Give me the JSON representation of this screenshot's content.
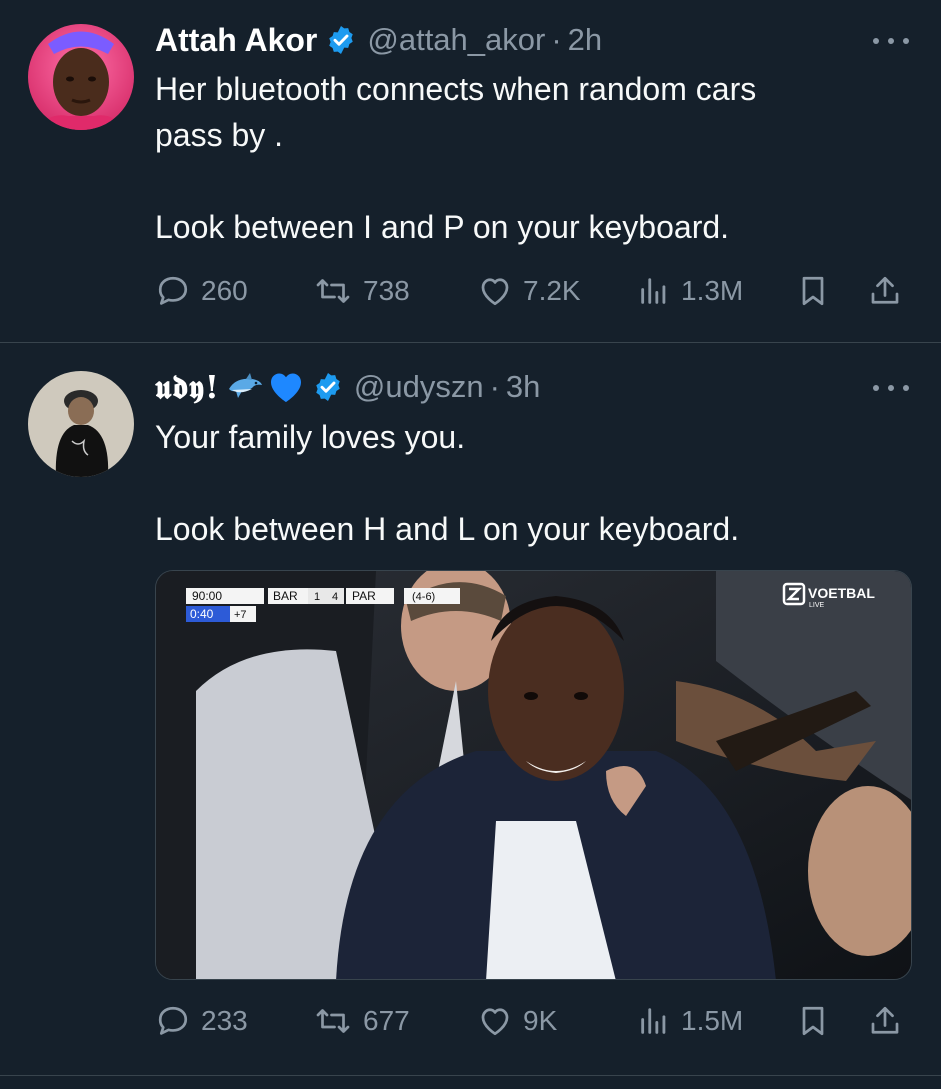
{
  "tweets": [
    {
      "author_name": "Attah Akor",
      "handle": "@attah_akor",
      "separator": "·",
      "time": "2h",
      "text_lines": [
        "Her bluetooth connects when random cars",
        "pass by .",
        "",
        "Look between I and P on your keyboard."
      ],
      "replies": "260",
      "retweets": "738",
      "likes": "7.2K",
      "views": "1.3M"
    },
    {
      "author_name": "𝖚𝖉𝖞!",
      "emojis": [
        "dolphin-emoji",
        "blue-heart-emoji"
      ],
      "handle": "@udyszn",
      "separator": "·",
      "time": "3h",
      "text_lines": [
        "Your family loves you.",
        "",
        "Look between H and L on your keyboard."
      ],
      "media": {
        "scoreboard": {
          "match_time": "90:00",
          "home": "BAR",
          "home_score": "1",
          "away_score": "4",
          "away": "PAR",
          "aggregate": "(4-6)",
          "extra_time": "0:40",
          "added": "+7"
        },
        "broadcaster": "VOETBAL",
        "broadcaster_sub": "LIVE"
      },
      "replies": "233",
      "retweets": "677",
      "likes": "9K",
      "views": "1.5M"
    }
  ],
  "colors": {
    "background": "#15202b",
    "secondary_text": "#8b98a5",
    "verified": "#1d9bf0",
    "divider": "#38444d"
  }
}
